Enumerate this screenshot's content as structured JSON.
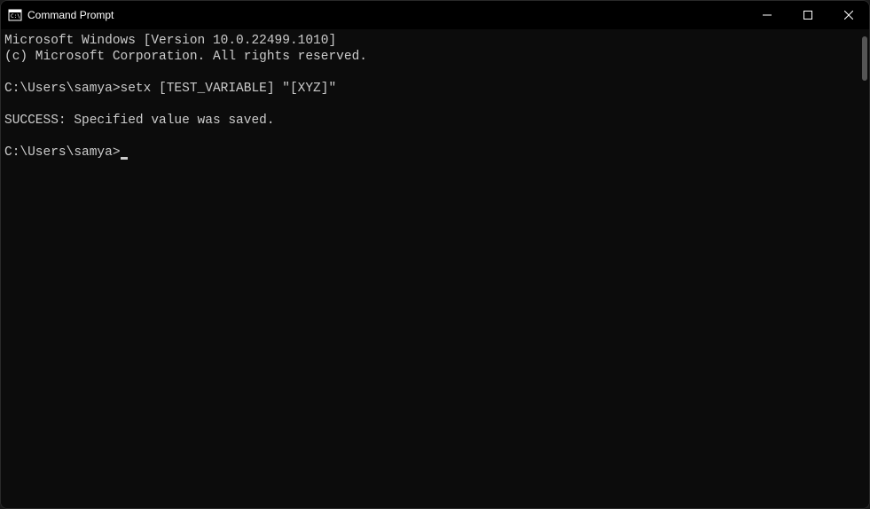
{
  "window": {
    "title": "Command Prompt"
  },
  "terminal": {
    "lines": [
      "Microsoft Windows [Version 10.0.22499.1010]",
      "(c) Microsoft Corporation. All rights reserved.",
      "",
      "C:\\Users\\samya>setx [TEST_VARIABLE] \"[XYZ]\"",
      "",
      "SUCCESS: Specified value was saved.",
      "",
      "C:\\Users\\samya>"
    ],
    "prompt_cursor": true
  }
}
